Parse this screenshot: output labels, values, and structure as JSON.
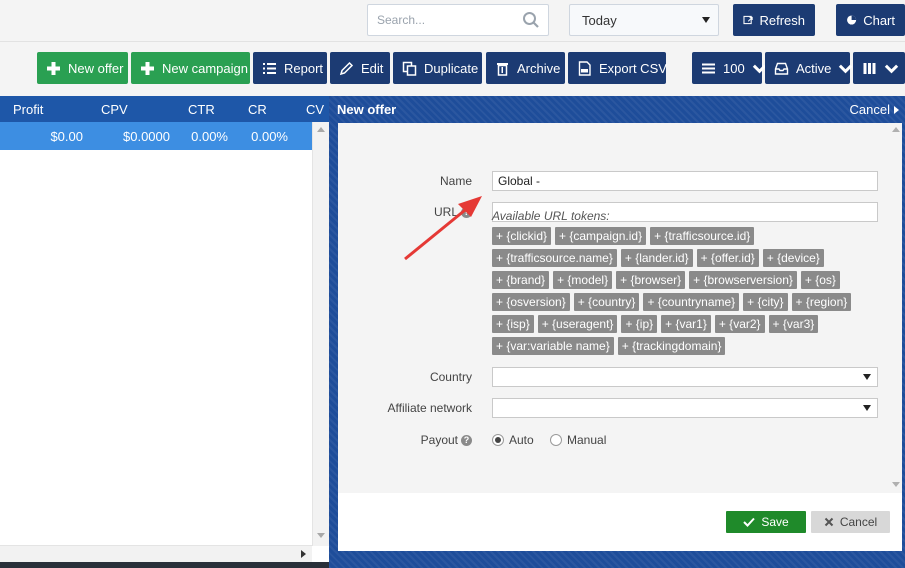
{
  "header": {
    "search_placeholder": "Search...",
    "date_range": "Today",
    "refresh_label": "Refresh",
    "chart_label": "Chart"
  },
  "toolbar": {
    "new_offer": "New offer",
    "new_campaign": "New campaign",
    "report": "Report",
    "edit": "Edit",
    "duplicate": "Duplicate",
    "archive": "Archive",
    "export_csv": "Export CSV",
    "page_size": "100",
    "status_filter": "Active"
  },
  "grid": {
    "columns": [
      "Profit",
      "CPV",
      "CTR",
      "CR",
      "CV"
    ],
    "rows": [
      [
        "$0.00",
        "$0.0000",
        "0.00%",
        "0.00%"
      ]
    ]
  },
  "panel": {
    "title": "New offer",
    "cancel_link": "Cancel",
    "fields": {
      "name_label": "Name",
      "name_value": "Global -",
      "url_label": "URL",
      "url_value": "",
      "tokens_label": "Available URL tokens:",
      "country_label": "Country",
      "country_value": "",
      "affiliate_label": "Affiliate network",
      "affiliate_value": "",
      "payout_label": "Payout",
      "payout_auto": "Auto",
      "payout_manual": "Manual"
    },
    "tokens": [
      "+ {clickid}",
      "+ {campaign.id}",
      "+ {trafficsource.id}",
      "+ {trafficsource.name}",
      "+ {lander.id}",
      "+ {offer.id}",
      "+ {device}",
      "+ {brand}",
      "+ {model}",
      "+ {browser}",
      "+ {browserversion}",
      "+ {os}",
      "+ {osversion}",
      "+ {country}",
      "+ {countryname}",
      "+ {city}",
      "+ {region}",
      "+ {isp}",
      "+ {useragent}",
      "+ {ip}",
      "+ {var1}",
      "+ {var2}",
      "+ {var3}",
      "+ {var:variable name}",
      "+ {trackingdomain}"
    ],
    "save_label": "Save",
    "cancel_label": "Cancel"
  },
  "colors": {
    "primary_navy": "#1c3b73",
    "accent_green": "#2aa052",
    "grid_header": "#1e57a8",
    "selected_row": "#3d8ee2",
    "token_gray": "#8a8a8a",
    "annotation_red": "#e53935"
  }
}
